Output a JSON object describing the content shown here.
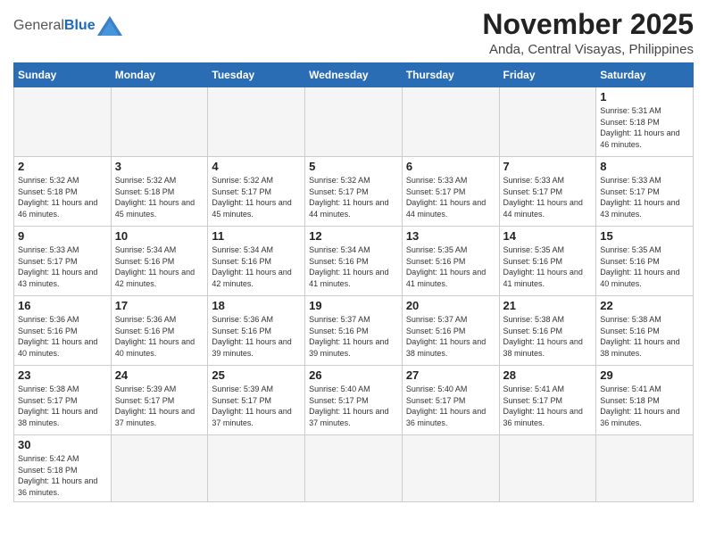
{
  "header": {
    "logo_general": "General",
    "logo_blue": "Blue",
    "month_title": "November 2025",
    "location": "Anda, Central Visayas, Philippines"
  },
  "weekdays": [
    "Sunday",
    "Monday",
    "Tuesday",
    "Wednesday",
    "Thursday",
    "Friday",
    "Saturday"
  ],
  "weeks": [
    [
      {
        "day": "",
        "empty": true
      },
      {
        "day": "",
        "empty": true
      },
      {
        "day": "",
        "empty": true
      },
      {
        "day": "",
        "empty": true
      },
      {
        "day": "",
        "empty": true
      },
      {
        "day": "",
        "empty": true
      },
      {
        "day": "1",
        "sunrise": "Sunrise: 5:31 AM",
        "sunset": "Sunset: 5:18 PM",
        "daylight": "Daylight: 11 hours and 46 minutes."
      }
    ],
    [
      {
        "day": "2",
        "sunrise": "Sunrise: 5:32 AM",
        "sunset": "Sunset: 5:18 PM",
        "daylight": "Daylight: 11 hours and 46 minutes."
      },
      {
        "day": "3",
        "sunrise": "Sunrise: 5:32 AM",
        "sunset": "Sunset: 5:18 PM",
        "daylight": "Daylight: 11 hours and 45 minutes."
      },
      {
        "day": "4",
        "sunrise": "Sunrise: 5:32 AM",
        "sunset": "Sunset: 5:17 PM",
        "daylight": "Daylight: 11 hours and 45 minutes."
      },
      {
        "day": "5",
        "sunrise": "Sunrise: 5:32 AM",
        "sunset": "Sunset: 5:17 PM",
        "daylight": "Daylight: 11 hours and 44 minutes."
      },
      {
        "day": "6",
        "sunrise": "Sunrise: 5:33 AM",
        "sunset": "Sunset: 5:17 PM",
        "daylight": "Daylight: 11 hours and 44 minutes."
      },
      {
        "day": "7",
        "sunrise": "Sunrise: 5:33 AM",
        "sunset": "Sunset: 5:17 PM",
        "daylight": "Daylight: 11 hours and 44 minutes."
      },
      {
        "day": "8",
        "sunrise": "Sunrise: 5:33 AM",
        "sunset": "Sunset: 5:17 PM",
        "daylight": "Daylight: 11 hours and 43 minutes."
      }
    ],
    [
      {
        "day": "9",
        "sunrise": "Sunrise: 5:33 AM",
        "sunset": "Sunset: 5:17 PM",
        "daylight": "Daylight: 11 hours and 43 minutes."
      },
      {
        "day": "10",
        "sunrise": "Sunrise: 5:34 AM",
        "sunset": "Sunset: 5:16 PM",
        "daylight": "Daylight: 11 hours and 42 minutes."
      },
      {
        "day": "11",
        "sunrise": "Sunrise: 5:34 AM",
        "sunset": "Sunset: 5:16 PM",
        "daylight": "Daylight: 11 hours and 42 minutes."
      },
      {
        "day": "12",
        "sunrise": "Sunrise: 5:34 AM",
        "sunset": "Sunset: 5:16 PM",
        "daylight": "Daylight: 11 hours and 41 minutes."
      },
      {
        "day": "13",
        "sunrise": "Sunrise: 5:35 AM",
        "sunset": "Sunset: 5:16 PM",
        "daylight": "Daylight: 11 hours and 41 minutes."
      },
      {
        "day": "14",
        "sunrise": "Sunrise: 5:35 AM",
        "sunset": "Sunset: 5:16 PM",
        "daylight": "Daylight: 11 hours and 41 minutes."
      },
      {
        "day": "15",
        "sunrise": "Sunrise: 5:35 AM",
        "sunset": "Sunset: 5:16 PM",
        "daylight": "Daylight: 11 hours and 40 minutes."
      }
    ],
    [
      {
        "day": "16",
        "sunrise": "Sunrise: 5:36 AM",
        "sunset": "Sunset: 5:16 PM",
        "daylight": "Daylight: 11 hours and 40 minutes."
      },
      {
        "day": "17",
        "sunrise": "Sunrise: 5:36 AM",
        "sunset": "Sunset: 5:16 PM",
        "daylight": "Daylight: 11 hours and 40 minutes."
      },
      {
        "day": "18",
        "sunrise": "Sunrise: 5:36 AM",
        "sunset": "Sunset: 5:16 PM",
        "daylight": "Daylight: 11 hours and 39 minutes."
      },
      {
        "day": "19",
        "sunrise": "Sunrise: 5:37 AM",
        "sunset": "Sunset: 5:16 PM",
        "daylight": "Daylight: 11 hours and 39 minutes."
      },
      {
        "day": "20",
        "sunrise": "Sunrise: 5:37 AM",
        "sunset": "Sunset: 5:16 PM",
        "daylight": "Daylight: 11 hours and 38 minutes."
      },
      {
        "day": "21",
        "sunrise": "Sunrise: 5:38 AM",
        "sunset": "Sunset: 5:16 PM",
        "daylight": "Daylight: 11 hours and 38 minutes."
      },
      {
        "day": "22",
        "sunrise": "Sunrise: 5:38 AM",
        "sunset": "Sunset: 5:16 PM",
        "daylight": "Daylight: 11 hours and 38 minutes."
      }
    ],
    [
      {
        "day": "23",
        "sunrise": "Sunrise: 5:38 AM",
        "sunset": "Sunset: 5:17 PM",
        "daylight": "Daylight: 11 hours and 38 minutes."
      },
      {
        "day": "24",
        "sunrise": "Sunrise: 5:39 AM",
        "sunset": "Sunset: 5:17 PM",
        "daylight": "Daylight: 11 hours and 37 minutes."
      },
      {
        "day": "25",
        "sunrise": "Sunrise: 5:39 AM",
        "sunset": "Sunset: 5:17 PM",
        "daylight": "Daylight: 11 hours and 37 minutes."
      },
      {
        "day": "26",
        "sunrise": "Sunrise: 5:40 AM",
        "sunset": "Sunset: 5:17 PM",
        "daylight": "Daylight: 11 hours and 37 minutes."
      },
      {
        "day": "27",
        "sunrise": "Sunrise: 5:40 AM",
        "sunset": "Sunset: 5:17 PM",
        "daylight": "Daylight: 11 hours and 36 minutes."
      },
      {
        "day": "28",
        "sunrise": "Sunrise: 5:41 AM",
        "sunset": "Sunset: 5:17 PM",
        "daylight": "Daylight: 11 hours and 36 minutes."
      },
      {
        "day": "29",
        "sunrise": "Sunrise: 5:41 AM",
        "sunset": "Sunset: 5:18 PM",
        "daylight": "Daylight: 11 hours and 36 minutes."
      }
    ],
    [
      {
        "day": "30",
        "sunrise": "Sunrise: 5:42 AM",
        "sunset": "Sunset: 5:18 PM",
        "daylight": "Daylight: 11 hours and 36 minutes."
      },
      {
        "day": "",
        "empty": true
      },
      {
        "day": "",
        "empty": true
      },
      {
        "day": "",
        "empty": true
      },
      {
        "day": "",
        "empty": true
      },
      {
        "day": "",
        "empty": true
      },
      {
        "day": "",
        "empty": true
      }
    ]
  ]
}
